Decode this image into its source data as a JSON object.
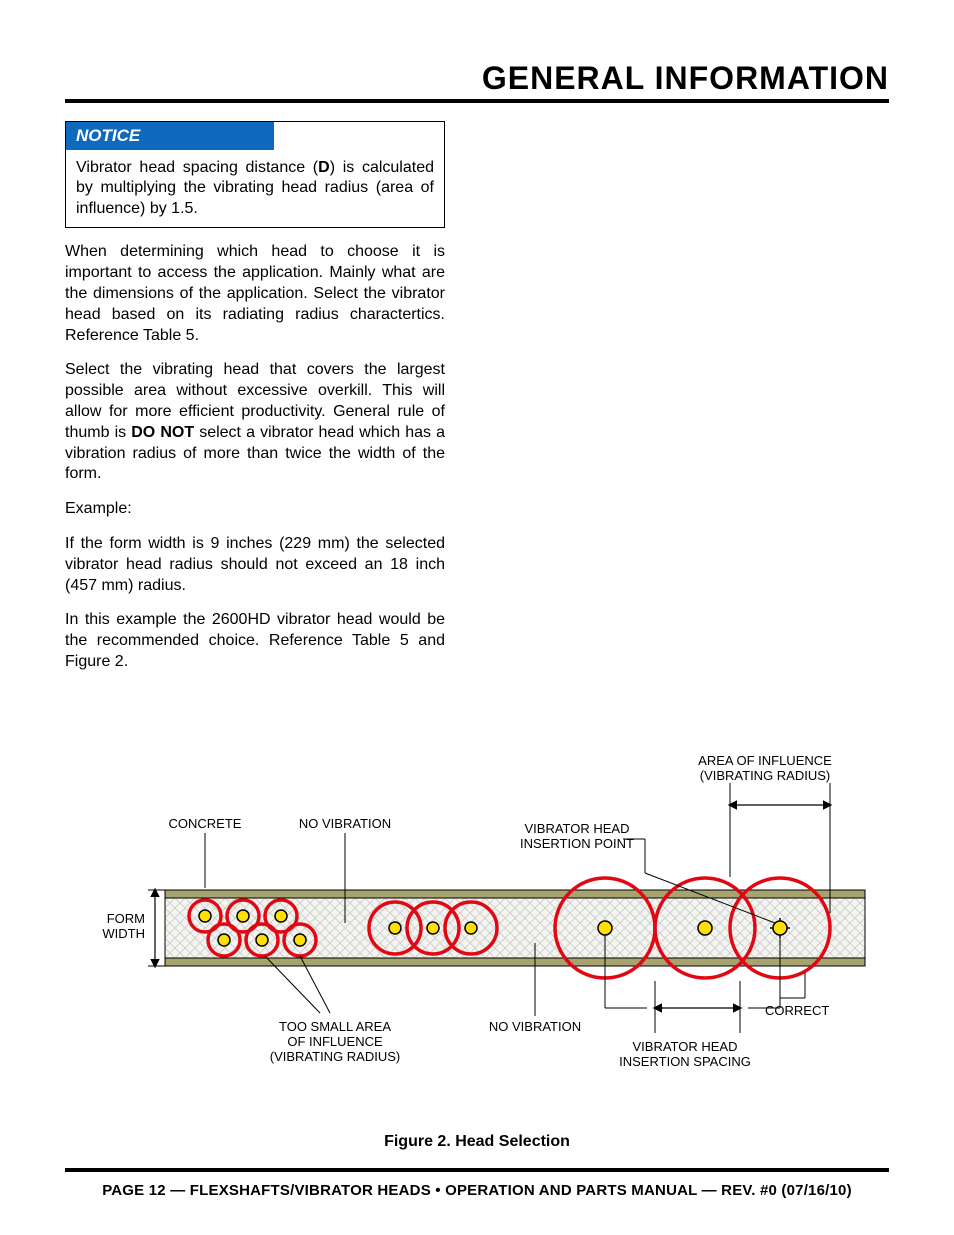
{
  "header": {
    "section_title": "GENERAL INFORMATION"
  },
  "notice": {
    "label": "NOTICE",
    "text_pre": "Vibrator head spacing distance (",
    "text_bold": "D",
    "text_post": ") is calculated by multiplying the vibrating head radius (area of influence) by 1.5."
  },
  "paragraphs": {
    "p1": "When determining which head to choose it is important to access the application. Mainly what are the dimensions of the application. Select the vibrator head based on its radiating radius charactertics. Reference Table 5.",
    "p2_pre": "Select the vibrating head that covers the largest possible area without excessive overkill. This will allow for more efficient productivity. General rule of thumb is ",
    "p2_bold": "DO NOT",
    "p2_post": " select a vibrator head which has a vibration radius of more than twice the width of the form.",
    "p3": "Example:",
    "p4": "If the form width is 9 inches (229 mm) the selected vibrator head radius should not exceed an 18 inch (457 mm) radius.",
    "p5": "In this example the 2600HD vibrator head would be the recommended choice. Reference Table 5 and Figure 2."
  },
  "figure": {
    "caption": "Figure 2. Head Selection",
    "labels": {
      "area_influence_1": "AREA OF INFLUENCE",
      "area_influence_2": "(VIBRATING RADIUS)",
      "concrete": "CONCRETE",
      "no_vibration": "NO VIBRATION",
      "vibrator_head_ip_1": "VIBRATOR HEAD",
      "vibrator_head_ip_2": "INSERTION POINT",
      "form_width_1": "FORM",
      "form_width_2": "WIDTH",
      "too_small_1": "TOO SMALL AREA",
      "too_small_2": "OF INFLUENCE",
      "too_small_3": "(VIBRATING RADIUS)",
      "no_vibration_2": "NO VIBRATION",
      "vibrator_head_is_1": "VIBRATOR HEAD",
      "vibrator_head_is_2": "INSERTION SPACING",
      "correct": "CORRECT"
    }
  },
  "footer": {
    "text": "PAGE 12 — FLEXSHAFTS/VIBRATOR HEADS • OPERATION AND PARTS MANUAL — REV. #0 (07/16/10)"
  }
}
